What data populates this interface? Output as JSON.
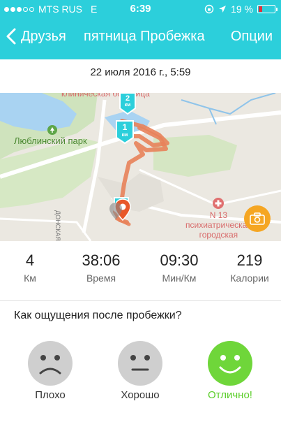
{
  "status_bar": {
    "carrier": "MTS RUS",
    "network": "E",
    "time": "6:39",
    "battery": "19 %"
  },
  "nav": {
    "back_label": "Друзья",
    "title": "пятница Пробежка",
    "options_label": "Опции"
  },
  "run": {
    "date": "22 июля 2016 г., 5:59"
  },
  "map": {
    "labels": {
      "hospital": "клиническая больница",
      "park": "Люблинский парк",
      "street": "ДОНСКАЯ",
      "hospital13_line1": "N 13",
      "hospital13_line2": "психиатрическая",
      "hospital13_line3": "городская"
    },
    "markers": [
      "2",
      "1",
      "1"
    ],
    "marker_unit": "км",
    "route_color": "#e8825a"
  },
  "stats": [
    {
      "value": "4",
      "label": "Км"
    },
    {
      "value": "38:06",
      "label": "Время"
    },
    {
      "value": "09:30",
      "label": "Мин/Км"
    },
    {
      "value": "219",
      "label": "Калории"
    }
  ],
  "feedback": {
    "question": "Как ощущения после пробежки?",
    "options": [
      {
        "label": "Плохо",
        "icon": "sad-face-icon",
        "selected": false
      },
      {
        "label": "Хорошо",
        "icon": "neutral-face-icon",
        "selected": false
      },
      {
        "label": "Отлично!",
        "icon": "happy-face-icon",
        "selected": true
      }
    ]
  },
  "colors": {
    "accent": "#2ccfdb",
    "selected": "#5bce2a",
    "camera": "#f5a623"
  }
}
